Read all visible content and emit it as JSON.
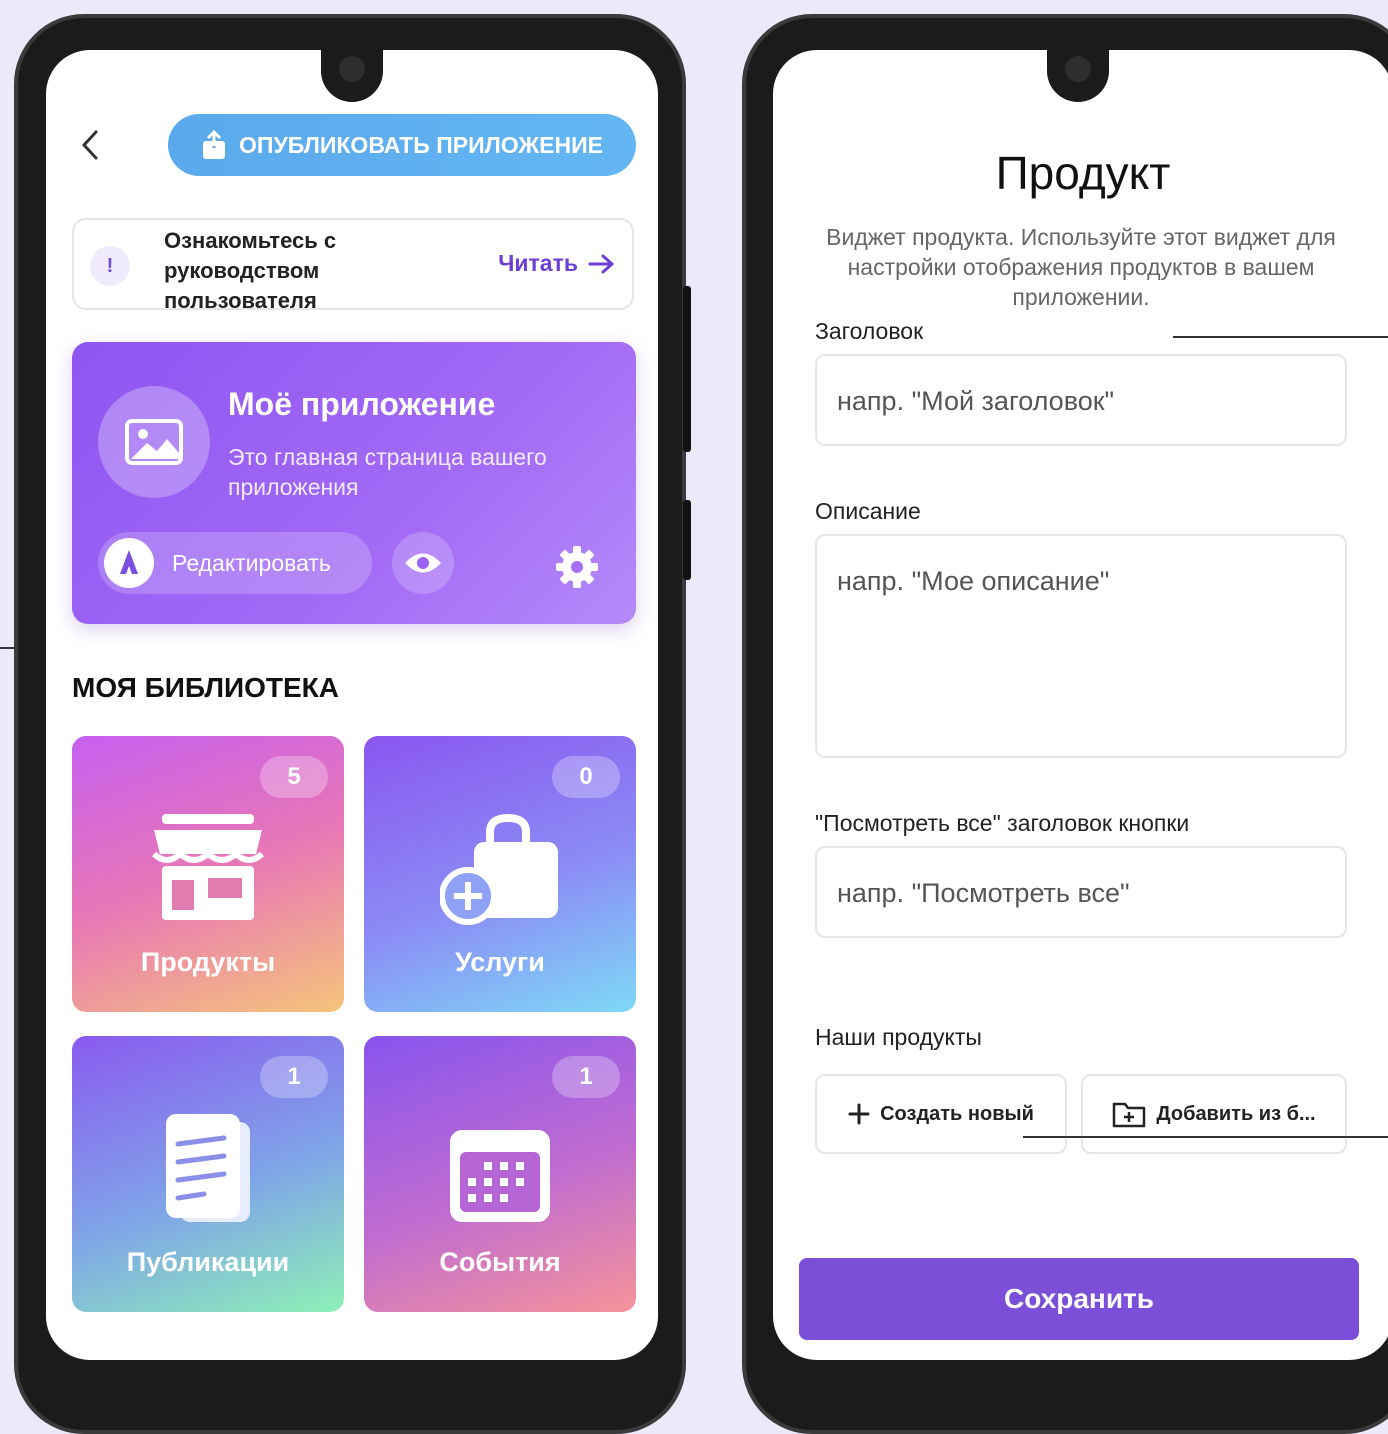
{
  "colors": {
    "background": "#ece9fa",
    "accent_purple": "#7b4fd7",
    "publish_blue": "#5aa9ec",
    "link_purple": "#6d3fd6"
  },
  "left_phone": {
    "header": {
      "back_icon": "chevron-left-icon",
      "publish_label": "ОПУБЛИКОВАТЬ ПРИЛОЖЕНИЕ",
      "publish_icon": "share-upload-icon"
    },
    "guide": {
      "icon": "info-circle-icon",
      "text": "Ознакомьтесь с руководством пользователя",
      "read_label": "Читать",
      "read_icon": "arrow-right-icon"
    },
    "app_card": {
      "title": "Моё приложение",
      "subtitle": "Это главная страница вашего приложения",
      "edit_label": "Редактировать",
      "edit_icon": "pen-nib-icon",
      "preview_icon": "eye-icon",
      "settings_icon": "gear-icon"
    },
    "library": {
      "title": "МОЯ БИБЛИОТЕКА",
      "tiles": [
        {
          "label": "Продукты",
          "count": "5",
          "icon": "storefront-icon"
        },
        {
          "label": "Услуги",
          "count": "0",
          "icon": "bag-plus-icon"
        },
        {
          "label": "Публикации",
          "count": "1",
          "icon": "documents-icon"
        },
        {
          "label": "События",
          "count": "1",
          "icon": "calendar-icon"
        }
      ]
    }
  },
  "right_phone": {
    "title": "Продукт",
    "description": "Виджет продукта. Используйте этот виджет для настройки отображения продуктов в вашем приложении.",
    "fields": {
      "heading": {
        "label": "Заголовок",
        "placeholder": "напр. \"Мой заголовок\""
      },
      "description": {
        "label": "Описание",
        "placeholder": "напр. \"Мое описание\""
      },
      "view_all": {
        "label": "\"Посмотреть все\" заголовок кнопки",
        "placeholder": "напр. \"Посмотреть все\""
      }
    },
    "products": {
      "label": "Наши продукты",
      "create_label": "Создать новый",
      "create_icon": "plus-icon",
      "add_label": "Добавить из б...",
      "add_icon": "folder-plus-icon"
    },
    "save_label": "Сохранить"
  }
}
